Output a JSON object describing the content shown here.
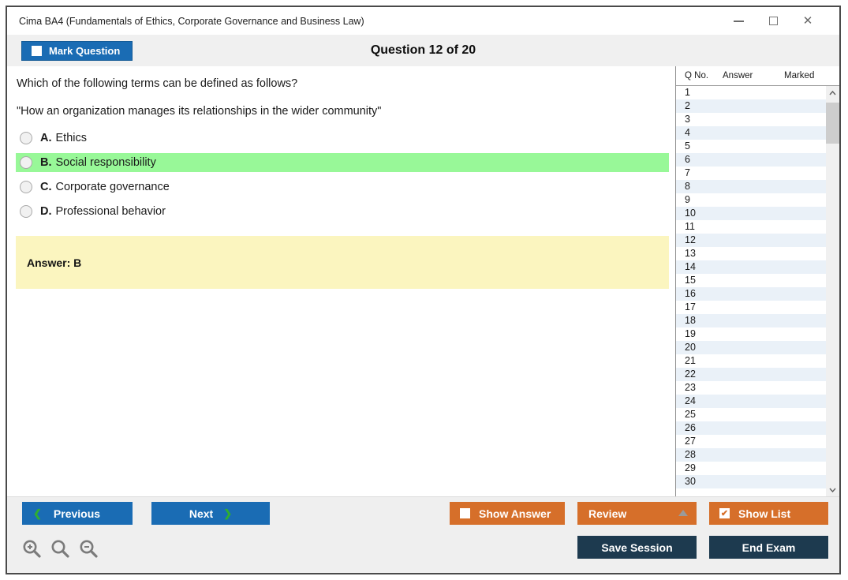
{
  "colors": {
    "blue": "#1a6cb4",
    "orange": "#d66f2a",
    "navy": "#1d3a4f",
    "green_highlight": "#98f898",
    "chevron_green": "#2fae2f",
    "answer_box_yellow": "#fbf5bf",
    "row_alt_blue": "#eaf1f8"
  },
  "window": {
    "title": "Cima BA4 (Fundamentals of Ethics, Corporate Governance and Business Law)",
    "controls": [
      "minimize",
      "maximize",
      "close"
    ]
  },
  "header": {
    "mark_question": "Mark Question",
    "question_counter": "Question 12 of 20"
  },
  "question": {
    "prompt": "Which of the following terms can be defined as follows?",
    "quote": "\"How an organization manages its relationships in the wider community\"",
    "options": [
      {
        "letter": "A.",
        "text": "Ethics",
        "highlighted": false
      },
      {
        "letter": "B.",
        "text": "Social responsibility",
        "highlighted": true
      },
      {
        "letter": "C.",
        "text": "Corporate governance",
        "highlighted": false
      },
      {
        "letter": "D.",
        "text": "Professional behavior",
        "highlighted": false
      }
    ],
    "answer": "Answer: B"
  },
  "sidebar": {
    "columns": [
      "Q No.",
      "Answer",
      "Marked"
    ],
    "rows": [
      "1",
      "2",
      "3",
      "4",
      "5",
      "6",
      "7",
      "8",
      "9",
      "10",
      "11",
      "12",
      "13",
      "14",
      "15",
      "16",
      "17",
      "18",
      "19",
      "20",
      "21",
      "22",
      "23",
      "24",
      "25",
      "26",
      "27",
      "28",
      "29",
      "30"
    ]
  },
  "footer": {
    "previous": "Previous",
    "next": "Next",
    "show_answer": "Show Answer",
    "review": "Review",
    "show_list": "Show List",
    "save_session": "Save Session",
    "end_exam": "End Exam",
    "zoom_tools": [
      "zoom-in-icon",
      "zoom-reset-icon",
      "zoom-out-icon"
    ]
  },
  "icons": {
    "chevron_left": "❮",
    "chevron_right": "❯",
    "close": "✕",
    "check": "✔"
  }
}
